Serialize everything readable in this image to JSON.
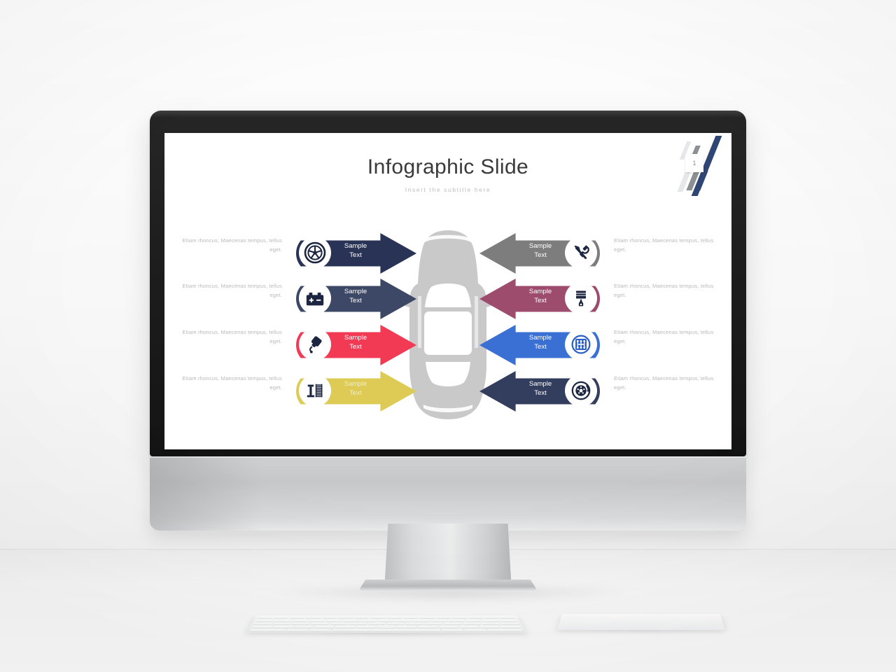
{
  "scene": {
    "device": "desktop-monitor-mockup",
    "peripherals": [
      "keyboard",
      "trackpad"
    ]
  },
  "slide": {
    "title": "Infographic Slide",
    "subtitle": "Insert  the  subtitle  here",
    "corner_badge_number": "1",
    "center_graphic": "car-top-view",
    "center_graphic_color": "#c9c9c9",
    "corner_colors": [
      "#2f4573",
      "#8c8f94",
      "#e6e7ea"
    ],
    "left_items": [
      {
        "label": "Sample\nText",
        "label_line1": "Sample",
        "label_line2": "Text",
        "description": "Etiam rhoncus, Maecenas tempus, tellus eget.",
        "color": "#283356",
        "icon": "wheel-rim-icon",
        "direction": "right"
      },
      {
        "label_line1": "Sample",
        "label_line2": "Text",
        "description": "Etiam rhoncus, Maecenas tempus, tellus eget.",
        "color": "#3d4866",
        "icon": "car-battery-icon",
        "direction": "right"
      },
      {
        "label_line1": "Sample",
        "label_line2": "Text",
        "description": "Etiam rhoncus, Maecenas tempus, tellus eget.",
        "color": "#f23a55",
        "icon": "spark-plug-icon",
        "direction": "right"
      },
      {
        "label_line1": "Sample",
        "label_line2": "Text",
        "description": "Etiam rhoncus, Maecenas tempus, tellus eget.",
        "color": "#ddcb55",
        "icon": "shock-absorber-icon",
        "direction": "right"
      }
    ],
    "right_items": [
      {
        "label_line1": "Sample",
        "label_line2": "Text",
        "description": "Etiam rhoncus, Maecenas tempus, tellus eget.",
        "color": "#7d7d7d",
        "icon": "wrench-screwdriver-icon",
        "direction": "left"
      },
      {
        "label_line1": "Sample",
        "label_line2": "Text",
        "description": "Etiam rhoncus, Maecenas tempus, tellus eget.",
        "color": "#9e4c6e",
        "icon": "piston-icon",
        "direction": "left"
      },
      {
        "label_line1": "Sample",
        "label_line2": "Text",
        "description": "Etiam rhoncus, Maecenas tempus, tellus eget.",
        "color": "#3a6fd4",
        "icon": "gear-shifter-icon",
        "direction": "left"
      },
      {
        "label_line1": "Sample",
        "label_line2": "Text",
        "description": "Etiam rhoncus, Maecenas tempus, tellus eget.",
        "color": "#333d5e",
        "icon": "brake-disc-icon",
        "direction": "left"
      }
    ]
  }
}
